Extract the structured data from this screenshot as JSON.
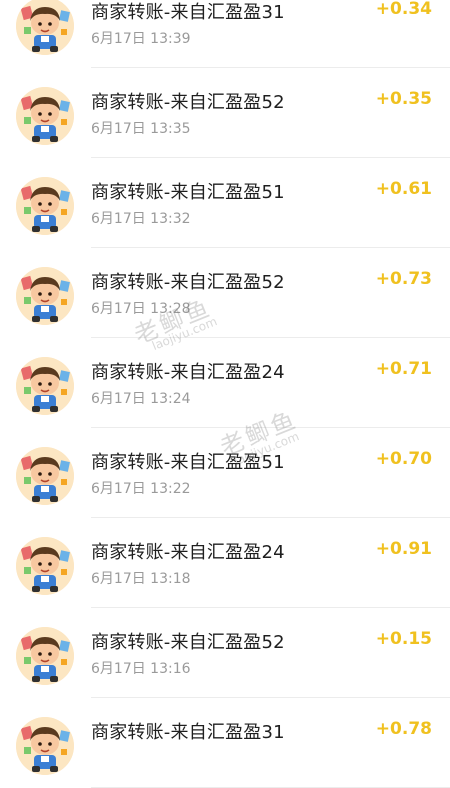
{
  "transactions": [
    {
      "title": "商家转账-来自汇盈盈31",
      "time": "6月17日 13:39",
      "amount": "+0.34"
    },
    {
      "title": "商家转账-来自汇盈盈52",
      "time": "6月17日 13:35",
      "amount": "+0.35"
    },
    {
      "title": "商家转账-来自汇盈盈51",
      "time": "6月17日 13:32",
      "amount": "+0.61"
    },
    {
      "title": "商家转账-来自汇盈盈52",
      "time": "6月17日 13:28",
      "amount": "+0.73"
    },
    {
      "title": "商家转账-来自汇盈盈24",
      "time": "6月17日 13:24",
      "amount": "+0.71"
    },
    {
      "title": "商家转账-来自汇盈盈51",
      "time": "6月17日 13:22",
      "amount": "+0.70"
    },
    {
      "title": "商家转账-来自汇盈盈24",
      "time": "6月17日 13:18",
      "amount": "+0.91"
    },
    {
      "title": "商家转账-来自汇盈盈52",
      "time": "6月17日 13:16",
      "amount": "+0.15"
    },
    {
      "title": "商家转账-来自汇盈盈31",
      "time": "",
      "amount": "+0.78"
    }
  ],
  "avatar_icon": "cartoon-boy-avatar-icon",
  "colors": {
    "amount": "#f0c11f",
    "title": "#1f1f1f",
    "time": "#9a9a9a",
    "divider": "#ececec"
  },
  "watermark": {
    "text": "老鲫鱼",
    "url": "laojiyu.com"
  }
}
